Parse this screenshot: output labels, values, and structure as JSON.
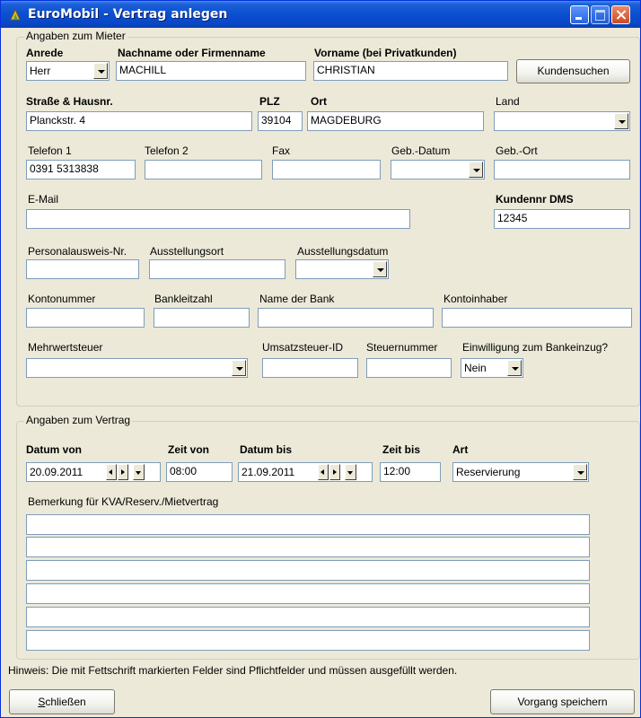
{
  "window": {
    "title": "EuroMobil - Vertrag anlegen",
    "icon": "app-icon",
    "controls": [
      "minimize-icon",
      "maximize-icon",
      "close-icon"
    ]
  },
  "tenant": {
    "legend": "Angaben zum Mieter",
    "salutation": {
      "label": "Anrede",
      "value": "Herr"
    },
    "last_name": {
      "label": "Nachname oder Firmenname",
      "value": "MACHILL"
    },
    "first_name": {
      "label": "Vorname (bei Privatkunden)",
      "value": "CHRISTIAN"
    },
    "customer_search_button": "Kundensuchen",
    "street": {
      "label": "Straße & Hausnr.",
      "value": "Planckstr. 4"
    },
    "zip": {
      "label": "PLZ",
      "value": "39104"
    },
    "city": {
      "label": "Ort",
      "value": "MAGDEBURG"
    },
    "country": {
      "label": "Land",
      "value": ""
    },
    "phone1": {
      "label": "Telefon 1",
      "value": "0391 5313838"
    },
    "phone2": {
      "label": "Telefon 2",
      "value": ""
    },
    "fax": {
      "label": "Fax",
      "value": ""
    },
    "birth_date": {
      "label": "Geb.-Datum",
      "value": ""
    },
    "birth_place": {
      "label": "Geb.-Ort",
      "value": ""
    },
    "email": {
      "label": "E-Mail",
      "value": ""
    },
    "customer_no": {
      "label": "Kundennr DMS",
      "value": "12345"
    },
    "id_card_no": {
      "label": "Personalausweis-Nr.",
      "value": ""
    },
    "issue_place": {
      "label": "Ausstellungsort",
      "value": ""
    },
    "issue_date": {
      "label": "Ausstellungsdatum",
      "value": ""
    },
    "account_no": {
      "label": "Kontonummer",
      "value": ""
    },
    "bank_code": {
      "label": "Bankleitzahl",
      "value": ""
    },
    "bank_name": {
      "label": "Name der Bank",
      "value": ""
    },
    "account_holder": {
      "label": "Kontoinhaber",
      "value": ""
    },
    "vat": {
      "label": "Mehrwertsteuer",
      "value": ""
    },
    "vat_id": {
      "label": "Umsatzsteuer-ID",
      "value": ""
    },
    "tax_no": {
      "label": "Steuernummer",
      "value": ""
    },
    "direct_debit": {
      "label": "Einwilligung zum Bankeinzug?",
      "value": "Nein"
    }
  },
  "contract": {
    "legend": "Angaben zum Vertrag",
    "date_from": {
      "label": "Datum von",
      "value": "20.09.2011"
    },
    "time_from": {
      "label": "Zeit von",
      "value": "08:00"
    },
    "date_to": {
      "label": "Datum bis",
      "value": "21.09.2011"
    },
    "time_to": {
      "label": "Zeit bis",
      "value": "12:00"
    },
    "type": {
      "label": "Art",
      "value": "Reservierung"
    },
    "remark": {
      "label": "Bemerkung für KVA/Reserv./Mietvertrag",
      "lines": [
        "",
        "",
        "",
        "",
        "",
        ""
      ]
    }
  },
  "footer": {
    "note": "Hinweis: Die mit Fettschrift markierten Felder sind Pflichtfelder und müssen ausgefüllt werden.",
    "close_button": {
      "prefix": "S",
      "rest": "chließen"
    },
    "save_button": "Vorgang speichern"
  }
}
